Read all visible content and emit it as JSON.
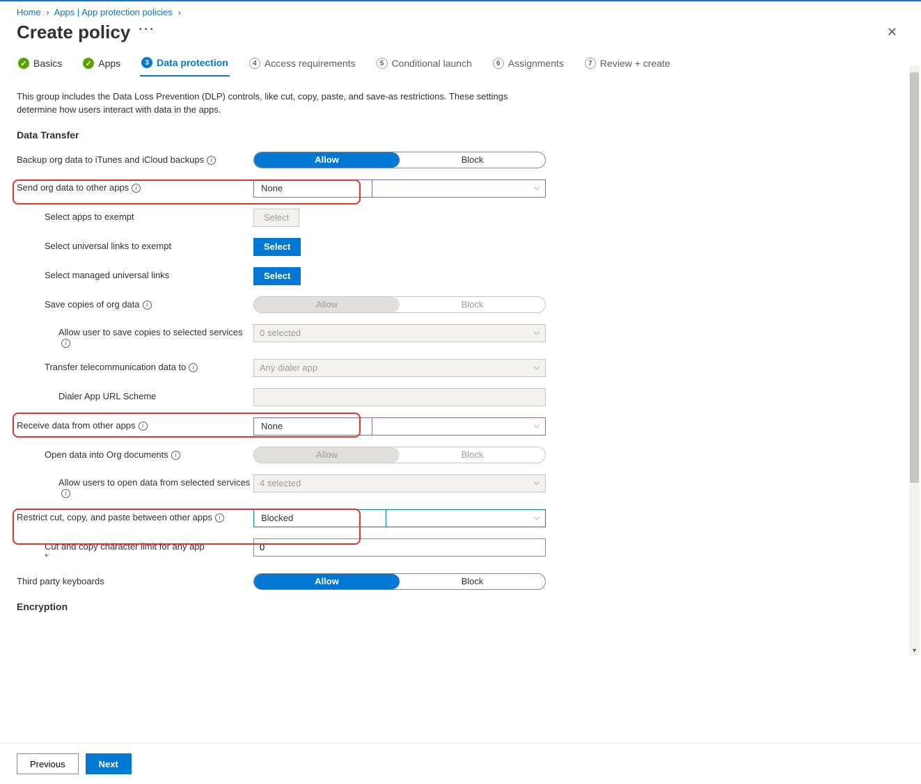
{
  "breadcrumb": {
    "home": "Home",
    "path": "Apps | App protection policies"
  },
  "title": "Create policy",
  "steps": [
    {
      "num": "✓",
      "label": "Basics"
    },
    {
      "num": "✓",
      "label": "Apps"
    },
    {
      "num": "3",
      "label": "Data protection"
    },
    {
      "num": "4",
      "label": "Access requirements"
    },
    {
      "num": "5",
      "label": "Conditional launch"
    },
    {
      "num": "6",
      "label": "Assignments"
    },
    {
      "num": "7",
      "label": "Review + create"
    }
  ],
  "description": "This group includes the Data Loss Prevention (DLP) controls, like cut, copy, paste, and save-as restrictions. These settings determine how users interact with data in the apps.",
  "section_data_transfer": "Data Transfer",
  "section_encryption": "Encryption",
  "toggle": {
    "allow": "Allow",
    "block": "Block"
  },
  "rows": {
    "backup": {
      "label": "Backup org data to iTunes and iCloud backups"
    },
    "send_org": {
      "label": "Send org data to other apps",
      "value": "None"
    },
    "exempt_apps": {
      "label": "Select apps to exempt",
      "btn": "Select"
    },
    "exempt_links": {
      "label": "Select universal links to exempt",
      "btn": "Select"
    },
    "managed_links": {
      "label": "Select managed universal links",
      "btn": "Select"
    },
    "save_copies": {
      "label": "Save copies of org data"
    },
    "save_services": {
      "label": "Allow user to save copies to selected services",
      "value": "0 selected"
    },
    "telecom": {
      "label": "Transfer telecommunication data to",
      "value": "Any dialer app"
    },
    "dialer_scheme": {
      "label": "Dialer App URL Scheme"
    },
    "receive": {
      "label": "Receive data from other apps",
      "value": "None"
    },
    "open_into": {
      "label": "Open data into Org documents"
    },
    "open_services": {
      "label": "Allow users to open data from selected services",
      "value": "4 selected"
    },
    "restrict_ccp": {
      "label": "Restrict cut, copy, and paste between other apps",
      "value": "Blocked"
    },
    "char_limit": {
      "label": "Cut and copy character limit for any app",
      "value": "0"
    },
    "third_party_kb": {
      "label": "Third party keyboards"
    }
  },
  "footer": {
    "previous": "Previous",
    "next": "Next"
  }
}
